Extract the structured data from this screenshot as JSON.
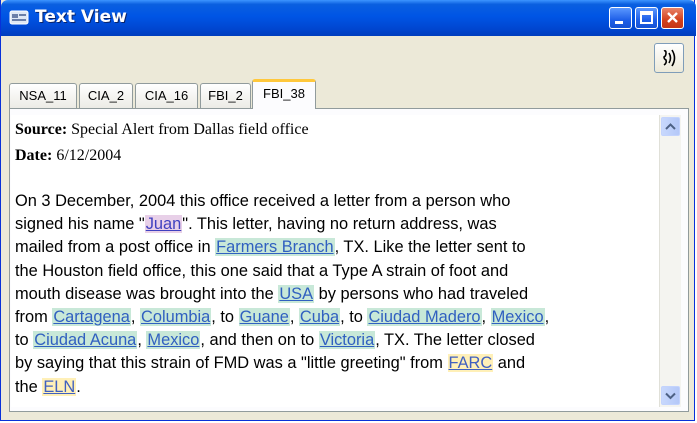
{
  "window": {
    "title": "Text View",
    "icon": "app-icon"
  },
  "toolbar": {
    "speak_button_icon": "speaker-icon"
  },
  "tabs": [
    {
      "label": "NSA_11",
      "active": false
    },
    {
      "label": "CIA_2",
      "active": false
    },
    {
      "label": "CIA_16",
      "active": false
    },
    {
      "label": "FBI_2",
      "active": false
    },
    {
      "label": "FBI_38",
      "active": true
    }
  ],
  "document": {
    "source_label": "Source:",
    "source_value": "Special Alert from Dallas field office",
    "date_label": "Date:",
    "date_value": "6/12/2004",
    "lines": [
      [
        {
          "t": "On 3 December, 2004 this office received a letter from a person who"
        }
      ],
      [
        {
          "t": "signed his name \""
        },
        {
          "t": "Juan",
          "e": "person"
        },
        {
          "t": "\". This letter, having no return address, was"
        }
      ],
      [
        {
          "t": "mailed from a post office in "
        },
        {
          "t": "Farmers Branch",
          "e": "location"
        },
        {
          "t": ", TX. Like the letter sent to"
        }
      ],
      [
        {
          "t": "the Houston field office, this one said that a Type A strain of foot and"
        }
      ],
      [
        {
          "t": "mouth disease was brought into the "
        },
        {
          "t": "USA",
          "e": "location"
        },
        {
          "t": " by persons who had traveled"
        }
      ],
      [
        {
          "t": "from "
        },
        {
          "t": "Cartagena",
          "e": "location"
        },
        {
          "t": ", "
        },
        {
          "t": "Columbia",
          "e": "location"
        },
        {
          "t": ", to "
        },
        {
          "t": "Guane",
          "e": "location"
        },
        {
          "t": ", "
        },
        {
          "t": "Cuba",
          "e": "location"
        },
        {
          "t": ", to "
        },
        {
          "t": "Ciudad Madero",
          "e": "location"
        },
        {
          "t": ", "
        },
        {
          "t": "Mexico",
          "e": "location"
        },
        {
          "t": ","
        }
      ],
      [
        {
          "t": "to "
        },
        {
          "t": "Ciudad Acuna",
          "e": "location"
        },
        {
          "t": ", "
        },
        {
          "t": "Mexico",
          "e": "location"
        },
        {
          "t": ", and then on to "
        },
        {
          "t": "Victoria",
          "e": "location"
        },
        {
          "t": ", TX. The letter closed"
        }
      ],
      [
        {
          "t": "by saying that this strain of FMD was a \"little greeting\" from "
        },
        {
          "t": "FARC",
          "e": "org"
        },
        {
          "t": " and"
        }
      ],
      [
        {
          "t": "the "
        },
        {
          "t": "ELN",
          "e": "org"
        },
        {
          "t": "."
        }
      ]
    ]
  },
  "colors": {
    "titlebar": "#0055e5",
    "person_highlight": "#e8d0e8",
    "location_highlight": "#c8e8d8",
    "org_highlight": "#fff0b8",
    "active_tab_accent": "#ffc83c"
  }
}
